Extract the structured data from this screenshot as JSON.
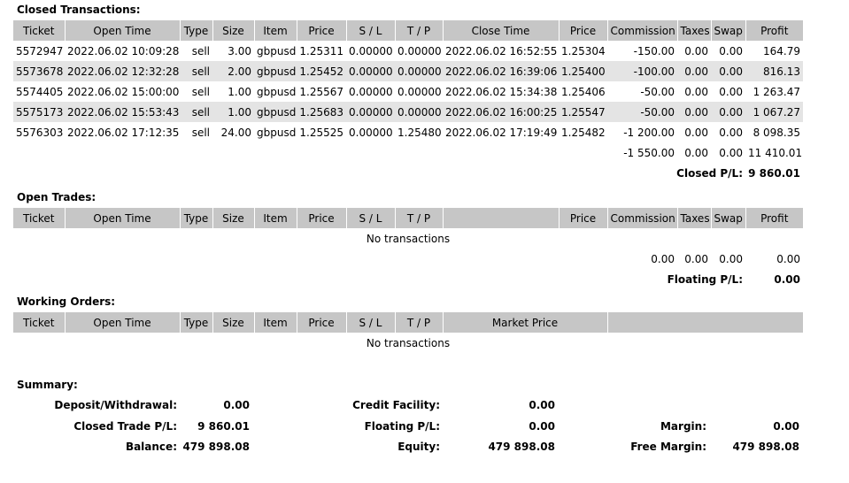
{
  "closed": {
    "title": "Closed Transactions:",
    "headers": [
      "Ticket",
      "Open Time",
      "Type",
      "Size",
      "Item",
      "Price",
      "S / L",
      "T / P",
      "Close Time",
      "Price",
      "Commission",
      "Taxes",
      "Swap",
      "Profit"
    ],
    "rows": [
      [
        "5572947",
        "2022.06.02 10:09:28",
        "sell",
        "3.00",
        "gbpusd",
        "1.25311",
        "0.00000",
        "0.00000",
        "2022.06.02 16:52:55",
        "1.25304",
        "-150.00",
        "0.00",
        "0.00",
        "164.79"
      ],
      [
        "5573678",
        "2022.06.02 12:32:28",
        "sell",
        "2.00",
        "gbpusd",
        "1.25452",
        "0.00000",
        "0.00000",
        "2022.06.02 16:39:06",
        "1.25400",
        "-100.00",
        "0.00",
        "0.00",
        "816.13"
      ],
      [
        "5574405",
        "2022.06.02 15:00:00",
        "sell",
        "1.00",
        "gbpusd",
        "1.25567",
        "0.00000",
        "0.00000",
        "2022.06.02 15:34:38",
        "1.25406",
        "-50.00",
        "0.00",
        "0.00",
        "1 263.47"
      ],
      [
        "5575173",
        "2022.06.02 15:53:43",
        "sell",
        "1.00",
        "gbpusd",
        "1.25683",
        "0.00000",
        "0.00000",
        "2022.06.02 16:00:25",
        "1.25547",
        "-50.00",
        "0.00",
        "0.00",
        "1 067.27"
      ],
      [
        "5576303",
        "2022.06.02 17:12:35",
        "sell",
        "24.00",
        "gbpusd",
        "1.25525",
        "0.00000",
        "1.25480",
        "2022.06.02 17:19:49",
        "1.25482",
        "-1 200.00",
        "0.00",
        "0.00",
        "8 098.35"
      ]
    ],
    "totals": {
      "commission": "-1 550.00",
      "taxes": "0.00",
      "swap": "0.00",
      "profit": "11 410.01"
    },
    "pl_label": "Closed P/L:",
    "pl_value": "9 860.01"
  },
  "open": {
    "title": "Open Trades:",
    "headers": [
      "Ticket",
      "Open Time",
      "Type",
      "Size",
      "Item",
      "Price",
      "S / L",
      "T / P",
      "",
      "Price",
      "Commission",
      "Taxes",
      "Swap",
      "Profit"
    ],
    "empty": "No transactions",
    "totals": {
      "commission": "0.00",
      "taxes": "0.00",
      "swap": "0.00",
      "profit": "0.00"
    },
    "pl_label": "Floating P/L:",
    "pl_value": "0.00"
  },
  "working": {
    "title": "Working Orders:",
    "headers": [
      "Ticket",
      "Open Time",
      "Type",
      "Size",
      "Item",
      "Price",
      "S / L",
      "T / P",
      "Market Price",
      ""
    ],
    "empty": "No transactions"
  },
  "summary": {
    "title": "Summary:",
    "deposit_label": "Deposit/Withdrawal:",
    "deposit_value": "0.00",
    "closed_label": "Closed Trade P/L:",
    "closed_value": "9 860.01",
    "balance_label": "Balance:",
    "balance_value": "479 898.08",
    "credit_label": "Credit Facility:",
    "credit_value": "0.00",
    "floating_label": "Floating P/L:",
    "floating_value": "0.00",
    "equity_label": "Equity:",
    "equity_value": "479 898.08",
    "margin_label": "Margin:",
    "margin_value": "0.00",
    "free_margin_label": "Free Margin:",
    "free_margin_value": "479 898.08"
  }
}
